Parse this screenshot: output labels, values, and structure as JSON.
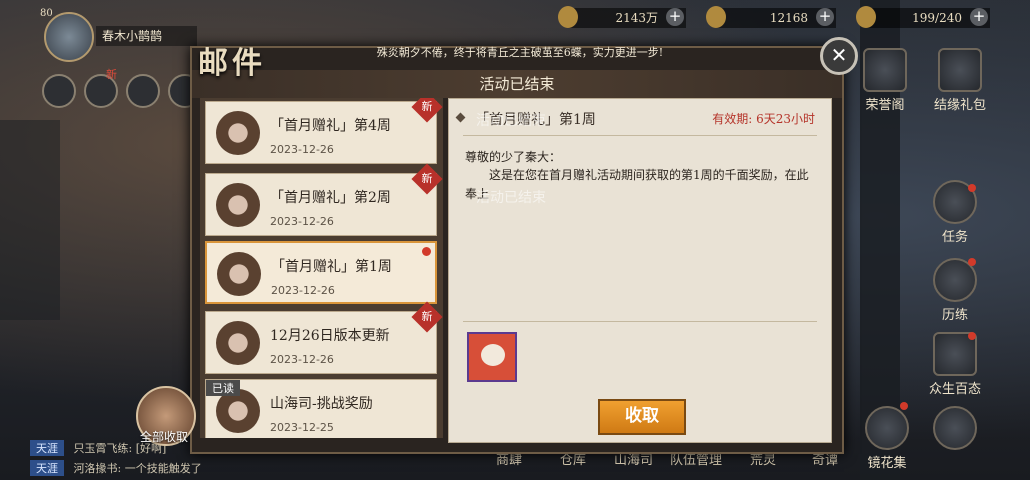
{
  "player": {
    "level": "80",
    "name": "春木小鹊鹊"
  },
  "resources": [
    {
      "value": "2143万",
      "plus": "+"
    },
    {
      "value": "12168",
      "plus": "+"
    },
    {
      "value": "199/240",
      "plus": "+"
    }
  ],
  "mail": {
    "title": "邮件",
    "banner": "殊炎朝夕不倦，终于将青丘之主破茧至6蝶，实力更进一步!",
    "header": "活动已结束",
    "close": "✕",
    "items": [
      {
        "name": "「首月赠礼」第4周",
        "date": "2023-12-26",
        "badge": "新"
      },
      {
        "name": "「首月赠礼」第2周",
        "date": "2023-12-26",
        "badge": "新"
      },
      {
        "name": "「首月赠礼」第1周",
        "date": "2023-12-26",
        "badge": ""
      },
      {
        "name": "12月26日版本更新",
        "date": "2023-12-26",
        "badge": "新"
      },
      {
        "name": "山海司-挑战奖励",
        "date": "2023-12-25",
        "badge": "已读"
      }
    ],
    "detail": {
      "title": "「首月赠礼」第1周",
      "ghost_title": "活动已结束",
      "validity_label": "有效期:",
      "validity": "6天23小时",
      "greeting": "尊敬的少了秦大：",
      "body": "这是在您在首月赠礼活动期间获取的第1周的千面奖励，在此奉上",
      "ghost_body": "活动已结束"
    },
    "claim_button": "收取",
    "claim_all": "全部收取"
  },
  "right_menu": [
    {
      "label": "荣誉阁"
    },
    {
      "label": "结缘礼包"
    },
    {
      "label": "任务"
    },
    {
      "label": "历练"
    },
    {
      "label": "众生百态"
    },
    {
      "label": "镜花集"
    }
  ],
  "bottom_nav": [
    "商肆",
    "仓库",
    "山海司",
    "队伍管理",
    "荒灵",
    "奇谭"
  ],
  "chat": [
    {
      "tag": "天涯",
      "text": "只玉霄飞练: [好啊]"
    },
    {
      "tag": "天涯",
      "text": "河洛掾书: 一个技能触发了"
    }
  ],
  "top_badge": "新"
}
